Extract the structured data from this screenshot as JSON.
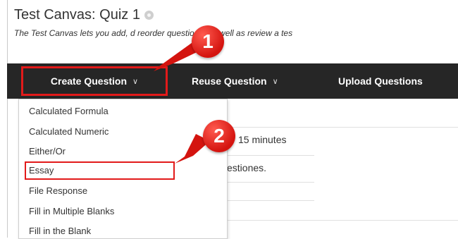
{
  "header": {
    "title": "Test Canvas: Quiz 1",
    "subtitle": "The Test Canvas lets you add, d reorder questions, as well as review a tes"
  },
  "toolbar": {
    "create_question": "Create Question",
    "reuse_question": "Reuse Question",
    "upload_questions": "Upload Questions"
  },
  "dropdown": {
    "items": [
      "Calculated Formula",
      "Calculated Numeric",
      "Either/Or",
      "Essay",
      "File Response",
      "Fill in Multiple Blanks",
      "Fill in the Blank"
    ],
    "highlighted": "Essay"
  },
  "content": {
    "line1": "15 minutes",
    "line2": "estiones."
  },
  "callouts": [
    "1",
    "2"
  ],
  "colors": {
    "toolbar_bg": "#262626",
    "highlight_red": "#e21a1a"
  }
}
